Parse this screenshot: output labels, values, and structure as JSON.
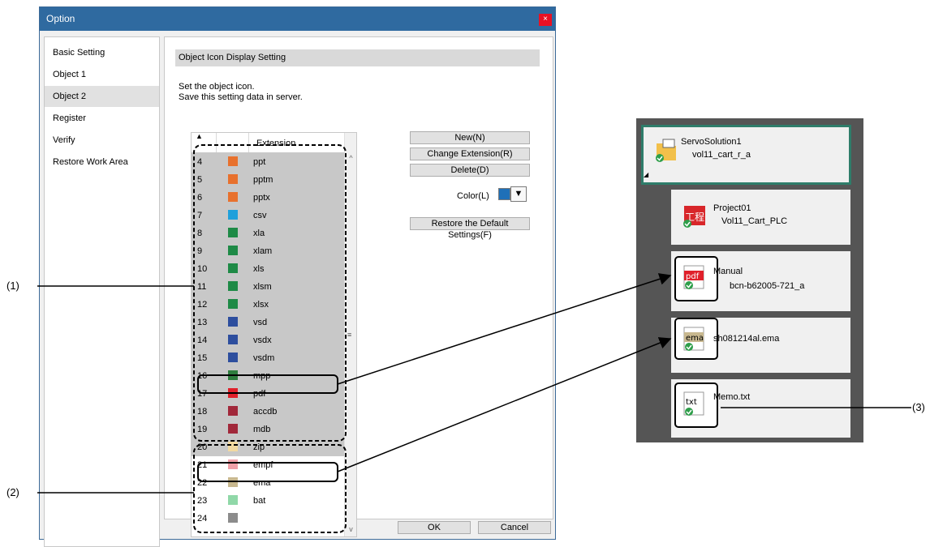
{
  "dialog": {
    "title": "Option",
    "close": "×",
    "nav": [
      "Basic Setting",
      "Object 1",
      "Object 2",
      "Register",
      "Verify",
      "Restore Work Area"
    ],
    "selected_nav": "Object 2",
    "section_title": "Object Icon Display Setting",
    "desc_line1": "Set the object icon.",
    "desc_line2": "Save this setting data in server.",
    "table": {
      "sort_icon": "▲",
      "column_extension": "Extension",
      "rows": [
        {
          "num": "4",
          "color": "#e8712d",
          "ext": "ppt"
        },
        {
          "num": "5",
          "color": "#e8712d",
          "ext": "pptm"
        },
        {
          "num": "6",
          "color": "#e8712d",
          "ext": "pptx"
        },
        {
          "num": "7",
          "color": "#1fa0db",
          "ext": "csv"
        },
        {
          "num": "8",
          "color": "#1e8a46",
          "ext": "xla"
        },
        {
          "num": "9",
          "color": "#1e8a46",
          "ext": "xlam"
        },
        {
          "num": "10",
          "color": "#1e8a46",
          "ext": "xls"
        },
        {
          "num": "11",
          "color": "#1e8a46",
          "ext": "xlsm"
        },
        {
          "num": "12",
          "color": "#1e8a46",
          "ext": "xlsx"
        },
        {
          "num": "13",
          "color": "#2d4e9e",
          "ext": "vsd"
        },
        {
          "num": "14",
          "color": "#2d4e9e",
          "ext": "vsdx"
        },
        {
          "num": "15",
          "color": "#2d4e9e",
          "ext": "vsdm"
        },
        {
          "num": "16",
          "color": "#2e7d3e",
          "ext": "mpp"
        },
        {
          "num": "17",
          "color": "#e0202a",
          "ext": "pdf"
        },
        {
          "num": "18",
          "color": "#a1283a",
          "ext": "accdb"
        },
        {
          "num": "19",
          "color": "#a1283a",
          "ext": "mdb"
        },
        {
          "num": "20",
          "color": "#f2d9a0",
          "ext": "zip"
        },
        {
          "num": "21",
          "color": "#f0a0a8",
          "ext": "empf"
        },
        {
          "num": "22",
          "color": "#c8b88f",
          "ext": "ema"
        },
        {
          "num": "23",
          "color": "#90d8a8",
          "ext": "bat"
        },
        {
          "num": "24",
          "color": "#8c8c8c",
          "ext": ""
        }
      ]
    },
    "buttons": {
      "new": "New(N)",
      "change_extension": "Change Extension(R)",
      "delete": "Delete(D)",
      "color_label": "Color(L)",
      "restore_defaults": "Restore the Default Settings(F)",
      "ok": "OK",
      "cancel": "Cancel"
    },
    "scroll": {
      "up": "^",
      "down": "v",
      "grip": "≡"
    }
  },
  "callouts": {
    "c1": "(1)",
    "c2": "(2)",
    "c3": "(3)"
  },
  "panel": {
    "root": {
      "title": "ServoSolution1",
      "subtitle": "vol11_cart_r_a"
    },
    "items": [
      {
        "title": "Project01",
        "subtitle": "Vol11_Cart_PLC",
        "icon_text": "工程"
      },
      {
        "title": "Manual",
        "subtitle": "bcn-b62005-721_a",
        "icon_text": "pdf",
        "icon_color": "#e0202a"
      },
      {
        "title": "sh081214al.ema",
        "subtitle": "",
        "icon_text": "ema",
        "icon_color": "#c8b88f"
      },
      {
        "title": "Memo.txt",
        "subtitle": "",
        "icon_text": "txt"
      }
    ]
  }
}
